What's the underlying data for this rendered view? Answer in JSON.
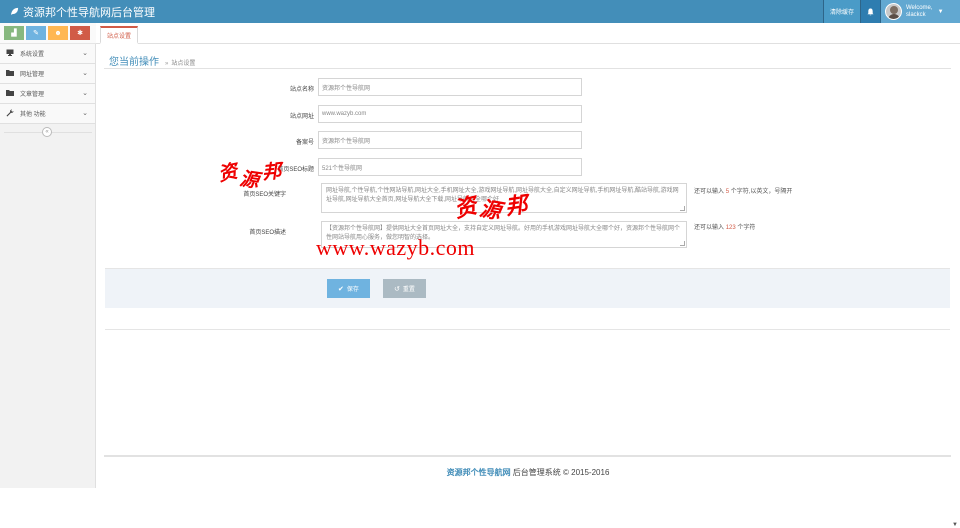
{
  "header": {
    "brand": "资源邦个性导航网后台管理",
    "clear_cache": "清除缓存",
    "welcome": "Welcome,",
    "username": "slackck",
    "colors": {
      "navbar": "#438eb9"
    }
  },
  "shortcuts": [
    {
      "icon": "chart-icon",
      "glyph": "▟",
      "color": "#87b87f"
    },
    {
      "icon": "pencil-icon",
      "glyph": "✎",
      "color": "#6fb3e0"
    },
    {
      "icon": "users-icon",
      "glyph": "☻",
      "color": "#ffb752"
    },
    {
      "icon": "cogs-icon",
      "glyph": "✱",
      "color": "#d15b47"
    }
  ],
  "tabs": {
    "active": "站点设置"
  },
  "sidebar": {
    "items": [
      {
        "label": "系统设置",
        "icon": "desktop-icon"
      },
      {
        "label": "网址管理",
        "icon": "folder-icon"
      },
      {
        "label": "文章管理",
        "icon": "folder-icon"
      },
      {
        "label": "其他 功能",
        "icon": "wrench-icon"
      }
    ]
  },
  "breadcrumb": {
    "title": "您当前操作",
    "separator": "»",
    "current": "站点设置"
  },
  "form": {
    "site_name": {
      "label": "站点名称",
      "value": "资源邦个性导航网"
    },
    "site_url": {
      "label": "站点网址",
      "value": "www.wazyb.com"
    },
    "icp": {
      "label": "备案号",
      "value": "资源邦个性导航网"
    },
    "home_title": {
      "label": "首页SEO标题",
      "value": "521个性导航网"
    },
    "seo_keywords": {
      "label": "首页SEO关键字",
      "value": "网址导航,个性导航,个性网站导航,网址大全,手机网址大全,游戏网址导航,网址导航大全,自定义网址导航,手机网址导航,酷站导航,游戏网址导航,网址导航大全首页,网址导航大全下载,网址导航大全哪个好",
      "hint_prefix": "还可以输入",
      "hint_count": "5",
      "hint_suffix": "个字符,以英文，号隔开"
    },
    "seo_description": {
      "label": "首页SEO描述",
      "value": "【资源邦个性导航网】提供网址大全首页网址大全，支持自定义网址导航。好用的手机游戏网址导航大全哪个好，资源邦个性导航网个性网站导航用心服务，做您明智的选择。",
      "hint_prefix": "还可以输入",
      "hint_count": "123",
      "hint_suffix": "个字符"
    }
  },
  "buttons": {
    "save": "保存",
    "reset": "重置"
  },
  "footer": {
    "brand": "资源邦个性导航网",
    "text": " 后台管理系统 © 2015-2016"
  },
  "watermark": {
    "url": "www.wazyb.com",
    "chars": [
      "资",
      "源",
      "邦",
      "资",
      "源",
      "邦"
    ]
  }
}
